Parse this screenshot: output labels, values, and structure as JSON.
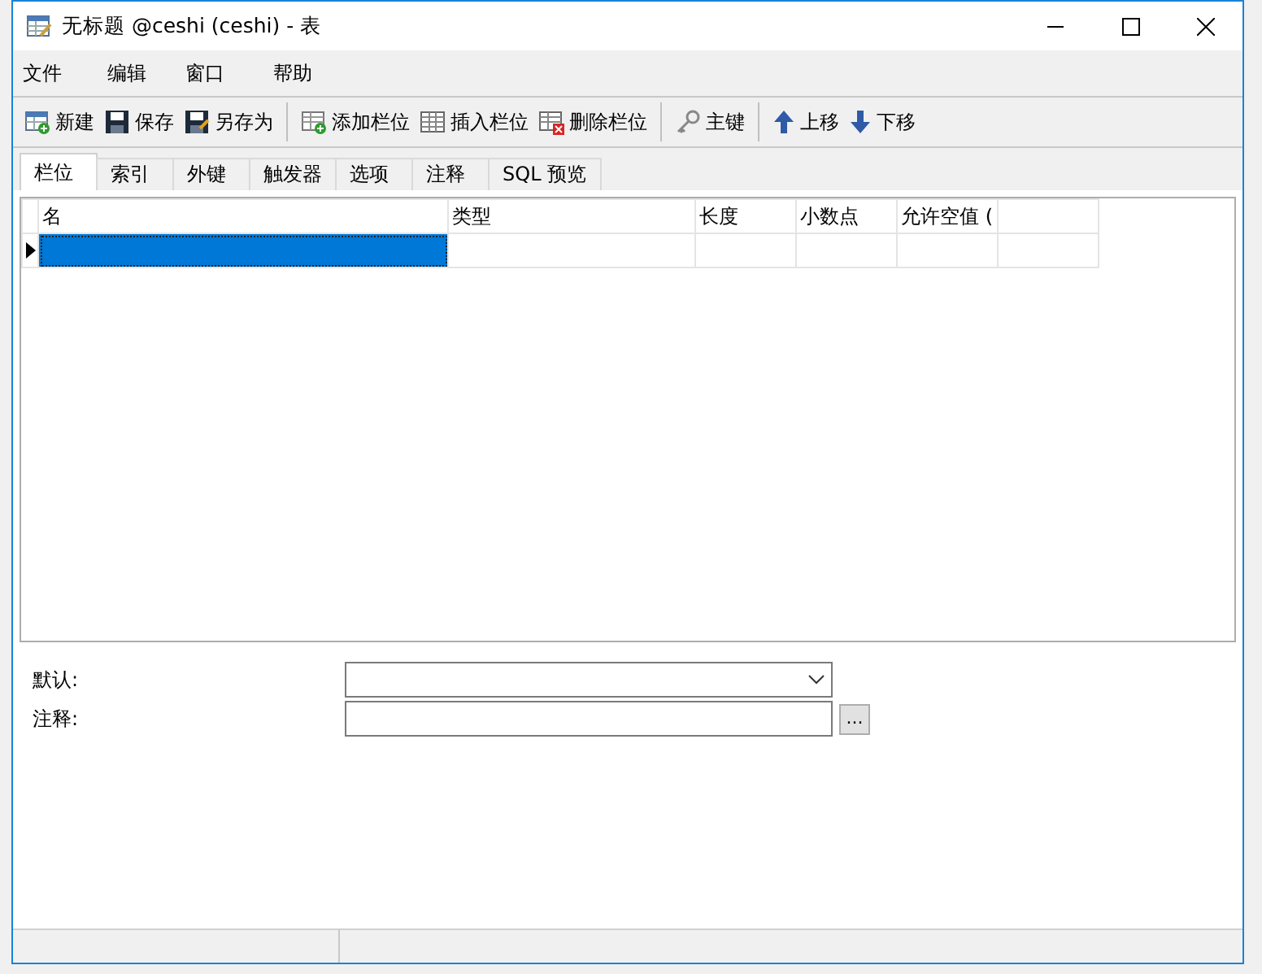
{
  "window": {
    "title": "无标题 @ceshi (ceshi) - 表"
  },
  "menu": [
    "文件",
    "编辑",
    "窗口",
    "帮助"
  ],
  "toolbar_groups": [
    [
      {
        "label": "新建",
        "kind": "new"
      },
      {
        "label": "保存",
        "kind": "save"
      },
      {
        "label": "另存为",
        "kind": "saveas"
      }
    ],
    [
      {
        "label": "添加栏位",
        "kind": "add"
      },
      {
        "label": "插入栏位",
        "kind": "insert"
      },
      {
        "label": "删除栏位",
        "kind": "delete"
      }
    ],
    [
      {
        "label": "主键",
        "kind": "key"
      }
    ],
    [
      {
        "label": "上移",
        "kind": "up"
      },
      {
        "label": "下移",
        "kind": "down"
      }
    ]
  ],
  "tabs": [
    {
      "label": "栏位",
      "selected": true
    },
    {
      "label": "索引",
      "selected": false
    },
    {
      "label": "外键",
      "selected": false
    },
    {
      "label": "触发器",
      "selected": false
    },
    {
      "label": "选项",
      "selected": false
    },
    {
      "label": "注释",
      "selected": false
    },
    {
      "label": "SQL 预览",
      "selected": false
    }
  ],
  "grid": {
    "columns": [
      "名",
      "类型",
      "长度",
      "小数点",
      "允许空值 ("
    ],
    "rows": [
      {
        "current": true,
        "cells": [
          {
            "selected": true
          },
          {
            "selected": false
          },
          {
            "selected": false
          },
          {
            "selected": false
          },
          {
            "selected": false
          }
        ]
      }
    ]
  },
  "properties": [
    {
      "label": "默认:",
      "kind": "dropdown"
    },
    {
      "label": "注释:",
      "kind": "text",
      "button": "..."
    }
  ]
}
